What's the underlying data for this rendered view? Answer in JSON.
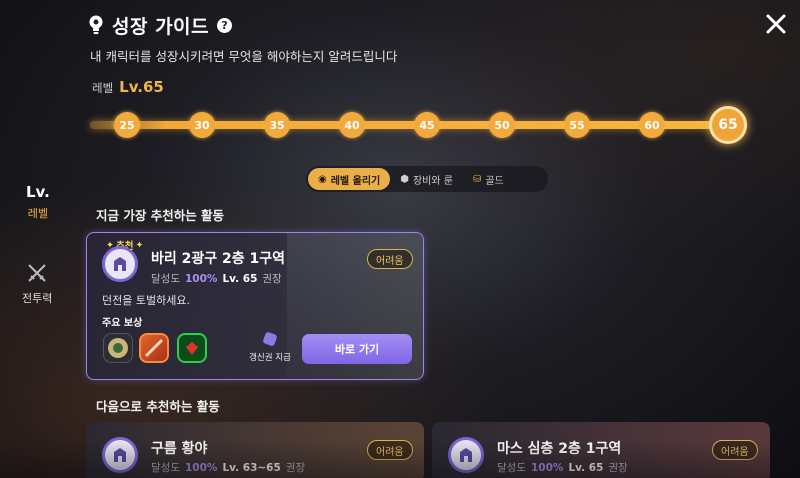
{
  "header": {
    "title": "성장 가이드",
    "help": "?",
    "subtitle": "내 캐릭터를 성장시키려면 무엇을 해야하는지 알려드립니다"
  },
  "level": {
    "label": "레벨",
    "value": "Lv.65"
  },
  "milestones": [
    "25",
    "30",
    "35",
    "40",
    "45",
    "50",
    "55",
    "60"
  ],
  "current_milestone": "65",
  "tabs": [
    {
      "label": "레벨 올리기",
      "icon": "level-up-icon",
      "active": true
    },
    {
      "label": "장비와 룬",
      "icon": "gear-rune-icon",
      "active": false
    },
    {
      "label": "골드",
      "icon": "gold-icon",
      "active": false
    }
  ],
  "sidebar": {
    "level": {
      "big": "Lv.",
      "small": "레벨"
    },
    "combat": {
      "small": "전투력",
      "icon": "crossed-swords-icon"
    }
  },
  "sections": {
    "top": "지금 가장 추천하는 활동",
    "next": "다음으로 추천하는 활동"
  },
  "main_card": {
    "badge": "추천",
    "title": "바리 2광구 2층 1구역",
    "progress_label": "달성도",
    "progress_value": "100%",
    "level": "Lv. 65",
    "level_suffix": "권장",
    "difficulty": "어려움",
    "description": "던전을 토벌하세요.",
    "rewards_label": "주요 보상",
    "ticket_label": "갱신권 지급",
    "go_label": "바로 가기"
  },
  "next_cards": [
    {
      "title": "구름 황야",
      "progress_label": "달성도",
      "progress_value": "100%",
      "level": "Lv. 63~65",
      "level_suffix": "권장",
      "difficulty": "어려움"
    },
    {
      "title": "마스 심층 2층 1구역",
      "progress_label": "달성도",
      "progress_value": "100%",
      "level": "Lv. 65",
      "level_suffix": "권장",
      "difficulty": "어려움"
    }
  ],
  "colors": {
    "accent_gold": "#f0b548",
    "accent_purple": "#8b72ec",
    "track": "#f3a93a"
  }
}
